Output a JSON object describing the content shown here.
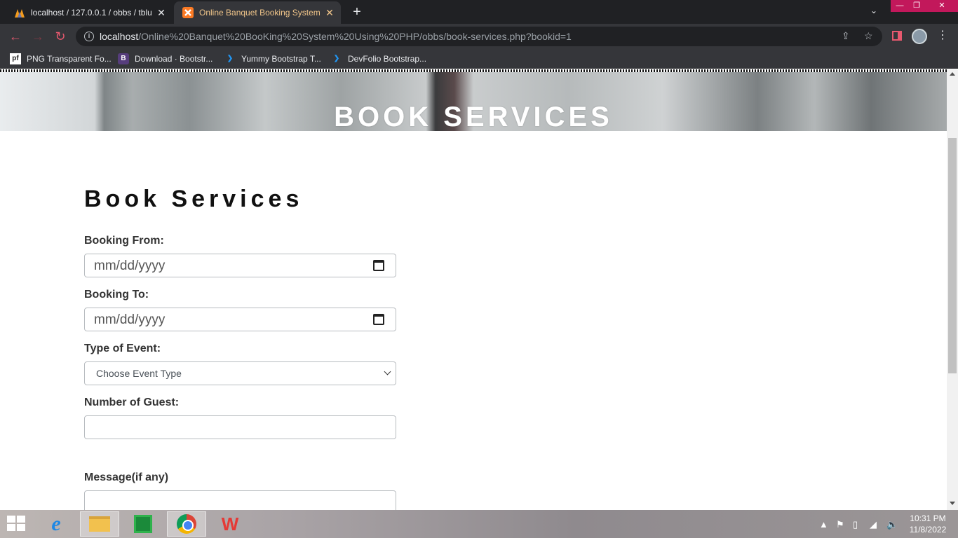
{
  "browser": {
    "tabs": [
      {
        "title": "localhost / 127.0.0.1 / obbs / tblu",
        "close": "✕"
      },
      {
        "title": "Online Banquet Booking System",
        "close": "✕"
      }
    ],
    "new_tab": "+",
    "window_buttons": {
      "minimize": "—",
      "maximize": "❐",
      "close": "✕"
    },
    "address": {
      "host": "localhost",
      "path": "/Online%20Banquet%20BooKing%20System%20Using%20PHP/obbs/book-services.php?bookid=1"
    },
    "bookmarks": [
      {
        "icon": "pf",
        "label": "PNG Transparent Fo..."
      },
      {
        "icon": "B",
        "label": "Download · Bootstr..."
      },
      {
        "icon": "❯",
        "label": "Yummy Bootstrap T..."
      },
      {
        "icon": "❯",
        "label": "DevFolio Bootstrap..."
      }
    ]
  },
  "page": {
    "hero_title": "BOOK SERVICES",
    "form_heading": "Book Services",
    "fields": {
      "booking_from": {
        "label": "Booking From:",
        "value": "mm/dd/yyyy"
      },
      "booking_to": {
        "label": "Booking To:",
        "value": "mm/dd/yyyy"
      },
      "event_type": {
        "label": "Type of Event:",
        "selected": "Choose Event Type"
      },
      "guests": {
        "label": "Number of Guest:",
        "value": ""
      },
      "message": {
        "label": "Message(if any)",
        "value": ""
      }
    }
  },
  "taskbar": {
    "clock_time": "10:31 PM",
    "clock_date": "11/8/2022"
  },
  "colors": {
    "tab_bar": "#202124",
    "toolbar": "#35363a",
    "active_tab_text": "#f0c58a",
    "accent": "#e8596f"
  }
}
